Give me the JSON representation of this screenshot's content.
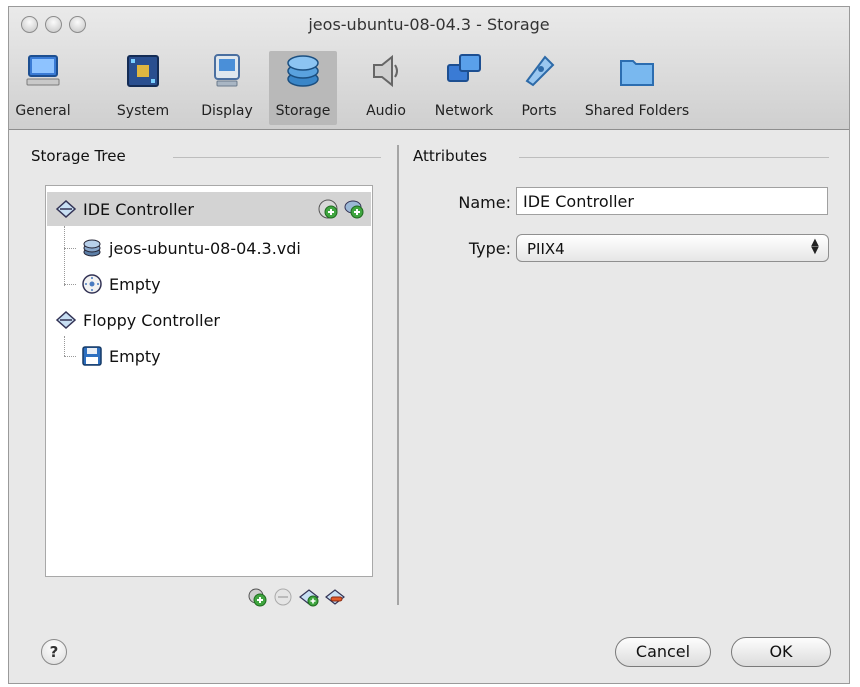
{
  "window": {
    "title": "jeos-ubuntu-08-04.3 - Storage"
  },
  "toolbar": {
    "items": [
      {
        "label": "General",
        "icon": "monitor-icon"
      },
      {
        "label": "System",
        "icon": "chip-icon"
      },
      {
        "label": "Display",
        "icon": "display-icon"
      },
      {
        "label": "Storage",
        "icon": "disk-stack-icon",
        "selected": true
      },
      {
        "label": "Audio",
        "icon": "speaker-icon"
      },
      {
        "label": "Network",
        "icon": "network-icon"
      },
      {
        "label": "Ports",
        "icon": "ports-icon"
      },
      {
        "label": "Shared Folders",
        "icon": "folder-icon"
      }
    ]
  },
  "storage_tree": {
    "heading": "Storage Tree",
    "items": [
      {
        "label": "IDE Controller",
        "type": "controller",
        "selected": true
      },
      {
        "label": "jeos-ubuntu-08-04.3.vdi",
        "type": "hard-disk"
      },
      {
        "label": "Empty",
        "type": "cd-dvd"
      },
      {
        "label": "Floppy Controller",
        "type": "controller"
      },
      {
        "label": "Empty",
        "type": "floppy"
      }
    ]
  },
  "attributes": {
    "heading": "Attributes",
    "name_label": "Name:",
    "name_value": "IDE Controller",
    "type_label": "Type:",
    "type_value": "PIIX4"
  },
  "buttons": {
    "help": "?",
    "cancel": "Cancel",
    "ok": "OK"
  },
  "colors": {
    "selection": "#d3d3d3",
    "accent_green": "#3fa53f",
    "accent_blue": "#2d7fc8"
  }
}
